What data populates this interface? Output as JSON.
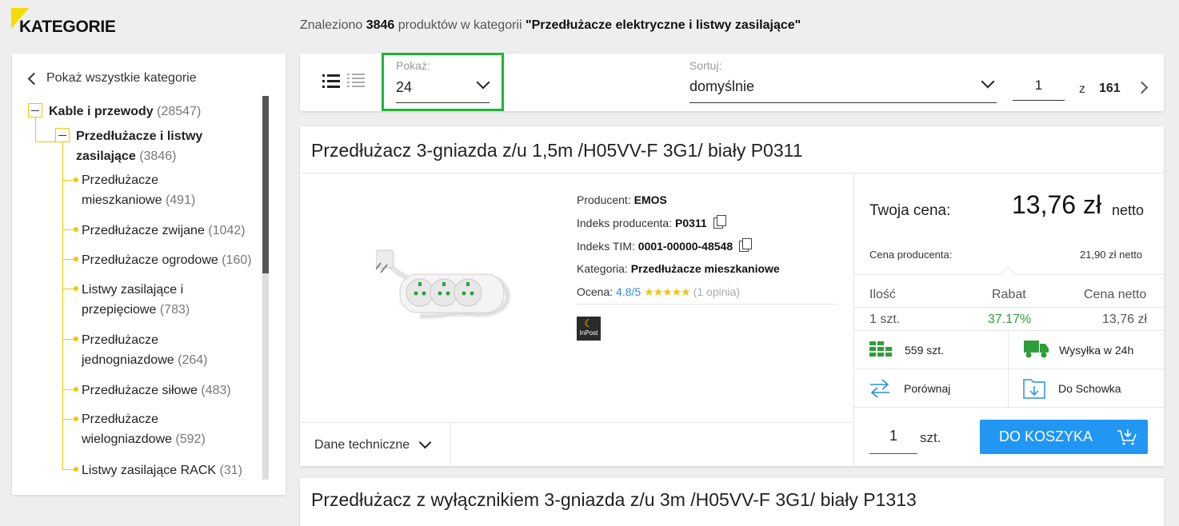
{
  "header": {
    "categories_title": "KATEGORIE",
    "found_prefix": "Znaleziono",
    "found_count": "3846",
    "found_middle": "produktów w kategorii",
    "found_category": "\"Przedłużacze elektryczne i listwy zasilające\""
  },
  "sidebar": {
    "back_label": "Pokaż wszystkie kategorie",
    "root": {
      "name": "Kable i przewody",
      "count": "(28547)"
    },
    "parent": {
      "name_line1": "Przedłużacze i listwy",
      "name_line2": "zasilające",
      "count": "(3846)"
    },
    "items": [
      {
        "line1": "Przedłużacze",
        "line2": "mieszkaniowe",
        "count": "(491)"
      },
      {
        "line1": "Przedłużacze zwijane",
        "line2": "",
        "count": "(1042)"
      },
      {
        "line1": "Przedłużacze ogrodowe",
        "line2": "",
        "count": "(160)"
      },
      {
        "line1": "Listwy zasilające i",
        "line2": "przepięciowe",
        "count": "(783)"
      },
      {
        "line1": "Przedłużacze",
        "line2": "jednogniazdowe",
        "count": "(264)"
      },
      {
        "line1": "Przedłużacze siłowe",
        "line2": "",
        "count": "(483)"
      },
      {
        "line1": "Przedłużacze",
        "line2": "wielogniazdowe",
        "count": "(592)"
      },
      {
        "line1": "Listwy zasilające RACK",
        "line2": "",
        "count": "(31)"
      }
    ]
  },
  "toolbar": {
    "show_label": "Pokaż:",
    "show_value": "24",
    "sort_label": "Sortuj:",
    "sort_value": "domyślnie",
    "page_current": "1",
    "page_of": "z",
    "page_total": "161"
  },
  "product": {
    "title": "Przedłużacz 3-gniazda z/u 1,5m /H05VV-F 3G1/ biały P0311",
    "producer_label": "Producent:",
    "producer_value": "EMOS",
    "producer_index_label": "Indeks producenta:",
    "producer_index_value": "P0311",
    "tim_index_label": "Indeks TIM:",
    "tim_index_value": "0001-00000-48548",
    "category_label": "Kategoria:",
    "category_value": "Przedłużacze mieszkaniowe",
    "rating_label": "Ocena:",
    "rating_value": "4.8/5",
    "rating_stars": "★★★★★",
    "rating_opinions": "(1 opinia)",
    "inpost_text": "InPost",
    "tech_label": "Dane techniczne",
    "your_price_label": "Twoja cena:",
    "your_price_value": "13,76 zł",
    "your_price_suffix": "netto",
    "producer_price_label": "Cena producenta:",
    "producer_price_value": "21,90 zł netto",
    "table_headers": [
      "Ilość",
      "Rabat",
      "Cena netto"
    ],
    "table_row": [
      "1 szt.",
      "37.17%",
      "13,76 zł"
    ],
    "stock_label": "559 szt.",
    "shipping_label": "Wysyłka w 24h",
    "compare_label": "Porównaj",
    "clipboard_label": "Do Schowka",
    "qty_value": "1",
    "qty_unit": "szt.",
    "cart_label": "DO KOSZYKA"
  },
  "next_product": {
    "title": "Przedłużacz z wyłącznikiem 3-gniazda z/u 3m /H05VV-F 3G1/ biały P1313"
  },
  "colors": {
    "accent_yellow": "#f5dc00",
    "highlight_green": "#1fb43a",
    "button_blue": "#2196f3",
    "discount_green": "#2e9e3a",
    "icon_green": "#2e9e3a",
    "icon_blue": "#2a8fd9"
  }
}
